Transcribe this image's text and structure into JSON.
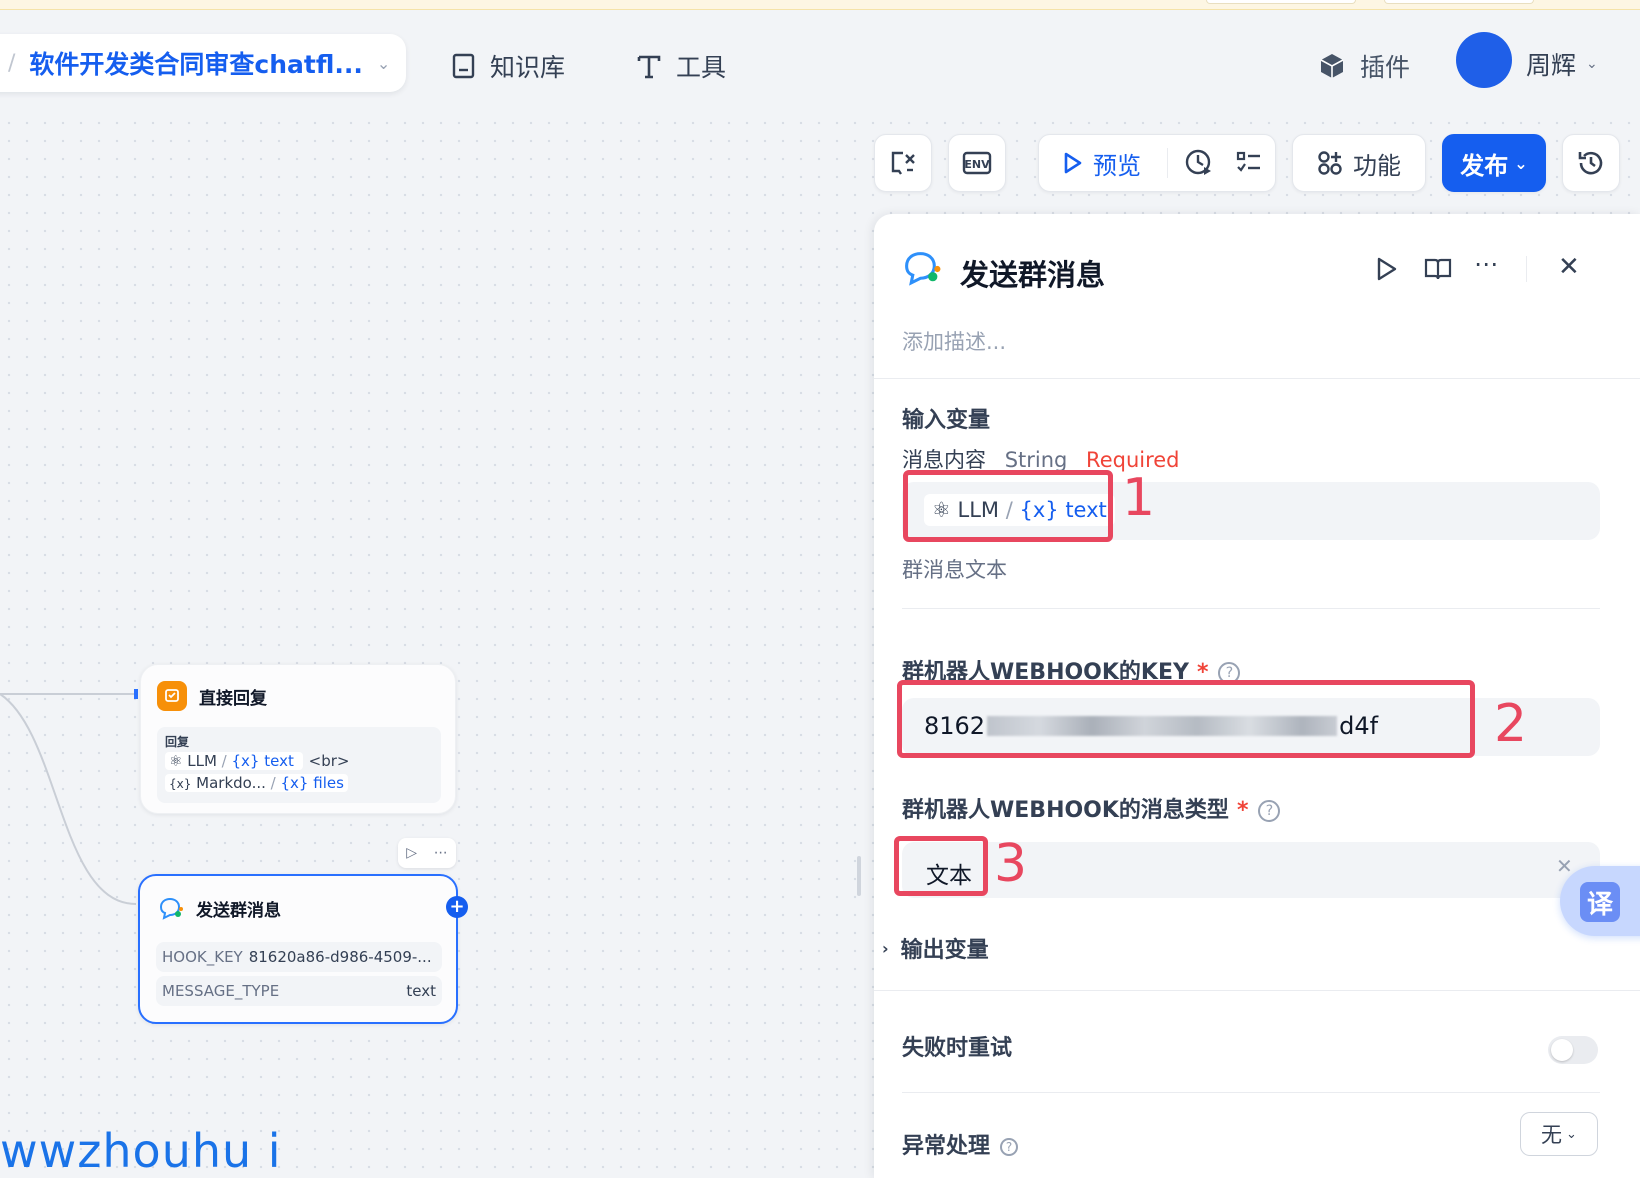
{
  "header": {
    "app_name": "软件开发类合同审查chatfl...",
    "nav": [
      {
        "label": "知识库",
        "icon": "book-icon"
      },
      {
        "label": "工具",
        "icon": "tool-icon"
      }
    ],
    "plugins_label": "插件",
    "user_name": "周辉"
  },
  "toolbar": {
    "preview_label": "预览",
    "features_label": "功能",
    "publish_label": "发布",
    "env_label": "ENV"
  },
  "nodes": {
    "direct_reply": {
      "title": "直接回复",
      "reply_label": "回复",
      "line1_source": "LLM",
      "line1_var": "{x} text",
      "line1_tail": "<br>",
      "line2_source": "Markdo...",
      "line2_var": "{x} files"
    },
    "send_group": {
      "title": "发送群消息",
      "row1_key": "HOOK_KEY",
      "row1_value": "81620a86-d986-4509-...",
      "row2_key": "MESSAGE_TYPE",
      "row2_value": "text"
    }
  },
  "panel": {
    "title": "发送群消息",
    "description_placeholder": "添加描述...",
    "input_vars_title": "输入变量",
    "field1_name": "消息内容",
    "field1_type": "String",
    "field1_required": "Required",
    "field1_source": "LLM",
    "field1_var": "{x} text",
    "field1_hint": "群消息文本",
    "field2_label": "群机器人WEBHOOK的KEY",
    "field2_value_start": "8162",
    "field2_value_end": "d4f",
    "field3_label": "群机器人WEBHOOK的消息类型",
    "field3_value": "文本",
    "output_vars_title": "输出变量",
    "retry_label": "失败时重试",
    "error_label": "异常处理",
    "error_value": "无"
  },
  "annotations": [
    "1",
    "2",
    "3"
  ],
  "translate_label": "译",
  "watermark": "wwzhouhu i"
}
